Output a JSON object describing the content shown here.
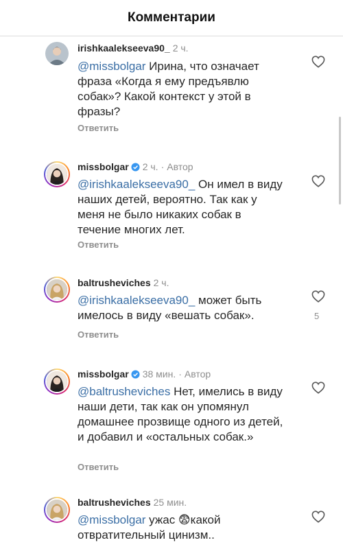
{
  "header": {
    "title": "Комментарии"
  },
  "reply_label": "Ответить",
  "comments": [
    {
      "username": "irishkaalekseeva90_",
      "verified": false,
      "time": "2 ч.",
      "author_badge": "",
      "mention": "@missbolgar",
      "body": " Ирина, что означает фраза «Когда я ему предъявлю собак»? Какой контекст у этой в фразы?",
      "likes": "",
      "avatar_icon": "avatar-photo-icon"
    },
    {
      "username": "missbolgar",
      "verified": true,
      "time": "2 ч.",
      "separator": "·",
      "author_badge": "Автор",
      "mention": "@irishkaalekseeva90_",
      "body": " Он имел в виду наших детей, вероятно. Так как у меня не было никаких собак в течение многих лет.",
      "likes": "",
      "avatar_icon": "avatar-photo-icon"
    },
    {
      "username": "baltrusheviches",
      "verified": false,
      "time": "2 ч.",
      "author_badge": "",
      "mention": "@irishkaalekseeva90_",
      "body": " может быть имелось в виду «вешать собак».",
      "likes": "5",
      "avatar_icon": "avatar-photo-icon"
    },
    {
      "username": "missbolgar",
      "verified": true,
      "time": "38 мин.",
      "separator": "·",
      "author_badge": "Автор",
      "mention": "@baltrusheviches",
      "body": " Нет, имелись в виду наши дети, так как он упомянул домашнее прозвище одного из детей, и добавил и «остальных собак.»",
      "likes": "",
      "avatar_icon": "avatar-photo-icon"
    },
    {
      "username": "baltrusheviches",
      "verified": false,
      "time": "25 мин.",
      "author_badge": "",
      "mention": "@missbolgar",
      "body": " ужас 😨какой отвратительный цинизм..",
      "likes": "",
      "avatar_icon": "avatar-photo-icon"
    }
  ],
  "icons": {
    "like": "heart-outline-icon",
    "verified": "verified-badge-icon"
  },
  "colors": {
    "mention": "#3a6ea5",
    "muted": "#8e8e8e",
    "verified": "#3897f0"
  }
}
